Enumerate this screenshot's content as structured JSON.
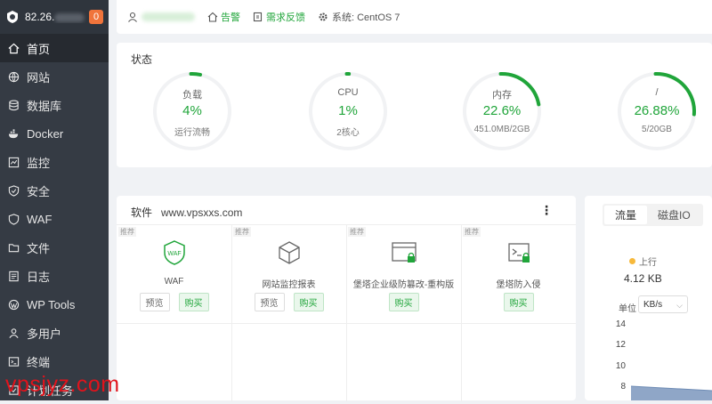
{
  "sidebar": {
    "ip": "82.26.",
    "badge": "0",
    "items": [
      {
        "label": "首页",
        "icon": "home-icon"
      },
      {
        "label": "网站",
        "icon": "globe-icon"
      },
      {
        "label": "数据库",
        "icon": "database-icon"
      },
      {
        "label": "Docker",
        "icon": "docker-icon"
      },
      {
        "label": "监控",
        "icon": "monitor-icon"
      },
      {
        "label": "安全",
        "icon": "shield-icon"
      },
      {
        "label": "WAF",
        "icon": "waf-shield-icon"
      },
      {
        "label": "文件",
        "icon": "folder-icon"
      },
      {
        "label": "日志",
        "icon": "log-icon"
      },
      {
        "label": "WP Tools",
        "icon": "wordpress-icon"
      },
      {
        "label": "多用户",
        "icon": "users-icon"
      },
      {
        "label": "终端",
        "icon": "terminal-icon"
      },
      {
        "label": "计划任务",
        "icon": "task-icon"
      }
    ]
  },
  "topbar": {
    "alert": "告警",
    "feedback": "需求反馈",
    "system": "系统: CentOS 7"
  },
  "status": {
    "title": "状态",
    "gauges": [
      {
        "label": "负载",
        "value": "4%",
        "sub": "运行流畅",
        "percent": 4
      },
      {
        "label": "CPU",
        "value": "1%",
        "sub": "2核心",
        "percent": 1
      },
      {
        "label": "内存",
        "value": "22.6%",
        "sub": "451.0MB/2GB",
        "percent": 22.6
      },
      {
        "label": "/",
        "value": "26.88%",
        "sub": "5/20GB",
        "percent": 26.88
      }
    ],
    "accent": "#20a53a"
  },
  "software": {
    "title": "软件",
    "site": "www.vpsxxs.com",
    "more": "⋮",
    "tag": "推荐",
    "items": [
      {
        "name": "WAF",
        "preview": "预览",
        "buy": "购买"
      },
      {
        "name": "网站监控报表",
        "preview": "预览",
        "buy": "购买"
      },
      {
        "name": "堡塔企业级防篡改-重构版",
        "buy": "购买"
      },
      {
        "name": "堡塔防入侵",
        "buy": "购买"
      }
    ]
  },
  "flow": {
    "tabs": [
      "流量",
      "磁盘IO"
    ],
    "up_label": "上行",
    "up_value": "4.12 KB",
    "unit_label": "单位",
    "unit_value": "KB/s",
    "yticks": [
      "14",
      "12",
      "10",
      "8"
    ]
  },
  "watermark": "vpsjyz.com"
}
